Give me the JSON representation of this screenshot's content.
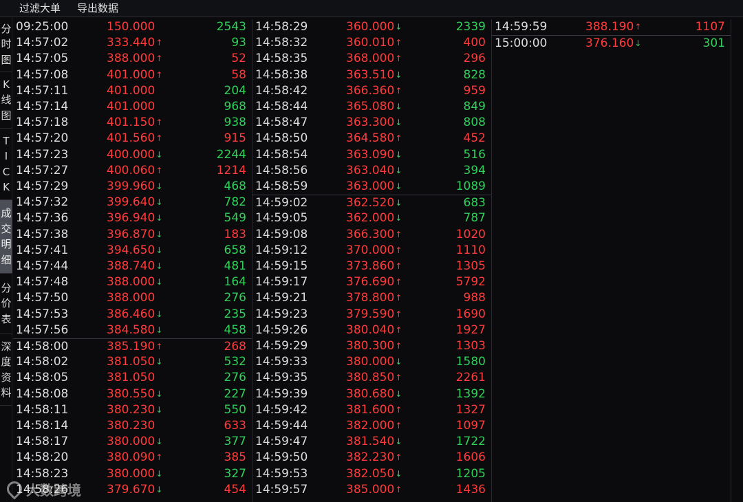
{
  "toolbar": {
    "filter_label": "过滤大单",
    "export_label": "导出数据"
  },
  "side_tabs": [
    {
      "chars": [
        "分",
        "时",
        "图"
      ],
      "active": false
    },
    {
      "chars": [
        "K",
        "线",
        "图"
      ],
      "active": false
    },
    {
      "chars": [
        "T",
        "I",
        "C",
        "K"
      ],
      "active": false
    },
    {
      "chars": [
        "成",
        "交",
        "明",
        "细"
      ],
      "active": true
    },
    {
      "chars": [
        "分",
        "价",
        "表"
      ],
      "active": false
    },
    {
      "chars": [
        "深",
        "度",
        "资",
        "料"
      ],
      "active": false
    }
  ],
  "colors": {
    "up": "#ff3b3b",
    "down": "#2fd15a",
    "active_tab": "#4b4e57"
  },
  "columns": [
    [
      {
        "t": "09:25:00",
        "p": "150.000",
        "d": "",
        "v": "2543",
        "s": "sell"
      },
      {
        "t": "14:57:02",
        "p": "333.440",
        "d": "up",
        "v": "93",
        "s": "sell"
      },
      {
        "t": "14:57:05",
        "p": "388.000",
        "d": "up",
        "v": "52",
        "s": "buy"
      },
      {
        "t": "14:57:08",
        "p": "401.000",
        "d": "up",
        "v": "58",
        "s": "buy"
      },
      {
        "t": "14:57:11",
        "p": "401.000",
        "d": "",
        "v": "204",
        "s": "sell"
      },
      {
        "t": "14:57:14",
        "p": "401.000",
        "d": "",
        "v": "968",
        "s": "sell"
      },
      {
        "t": "14:57:18",
        "p": "401.150",
        "d": "up",
        "v": "938",
        "s": "sell"
      },
      {
        "t": "14:57:20",
        "p": "401.560",
        "d": "up",
        "v": "915",
        "s": "buy"
      },
      {
        "t": "14:57:23",
        "p": "400.000",
        "d": "down",
        "v": "2244",
        "s": "sell"
      },
      {
        "t": "14:57:27",
        "p": "400.060",
        "d": "up",
        "v": "1214",
        "s": "buy"
      },
      {
        "t": "14:57:29",
        "p": "399.960",
        "d": "down",
        "v": "468",
        "s": "sell"
      },
      {
        "t": "14:57:32",
        "p": "399.640",
        "d": "down",
        "v": "782",
        "s": "sell"
      },
      {
        "t": "14:57:36",
        "p": "396.940",
        "d": "down",
        "v": "549",
        "s": "sell"
      },
      {
        "t": "14:57:38",
        "p": "396.870",
        "d": "down",
        "v": "183",
        "s": "buy"
      },
      {
        "t": "14:57:41",
        "p": "394.650",
        "d": "down",
        "v": "658",
        "s": "sell"
      },
      {
        "t": "14:57:44",
        "p": "388.740",
        "d": "down",
        "v": "481",
        "s": "sell"
      },
      {
        "t": "14:57:48",
        "p": "388.000",
        "d": "down",
        "v": "164",
        "s": "sell"
      },
      {
        "t": "14:57:50",
        "p": "388.000",
        "d": "",
        "v": "276",
        "s": "sell"
      },
      {
        "t": "14:57:53",
        "p": "386.460",
        "d": "down",
        "v": "235",
        "s": "sell"
      },
      {
        "t": "14:57:56",
        "p": "384.580",
        "d": "down",
        "v": "458",
        "s": "sell"
      },
      {
        "t": "14:58:00",
        "p": "385.190",
        "d": "up",
        "v": "268",
        "s": "buy",
        "sep": true
      },
      {
        "t": "14:58:02",
        "p": "381.050",
        "d": "down",
        "v": "532",
        "s": "sell"
      },
      {
        "t": "14:58:05",
        "p": "381.050",
        "d": "",
        "v": "276",
        "s": "sell"
      },
      {
        "t": "14:58:08",
        "p": "380.550",
        "d": "down",
        "v": "227",
        "s": "sell"
      },
      {
        "t": "14:58:11",
        "p": "380.230",
        "d": "down",
        "v": "550",
        "s": "sell"
      },
      {
        "t": "14:58:14",
        "p": "380.230",
        "d": "",
        "v": "633",
        "s": "buy"
      },
      {
        "t": "14:58:17",
        "p": "380.000",
        "d": "down",
        "v": "377",
        "s": "sell"
      },
      {
        "t": "14:58:20",
        "p": "380.090",
        "d": "up",
        "v": "385",
        "s": "buy"
      },
      {
        "t": "14:58:23",
        "p": "380.000",
        "d": "down",
        "v": "327",
        "s": "sell"
      },
      {
        "t": "14:58:26",
        "p": "379.670",
        "d": "down",
        "v": "454",
        "s": "buy"
      }
    ],
    [
      {
        "t": "14:58:29",
        "p": "360.000",
        "d": "down",
        "v": "2339",
        "s": "sell"
      },
      {
        "t": "14:58:32",
        "p": "360.010",
        "d": "up",
        "v": "400",
        "s": "buy"
      },
      {
        "t": "14:58:35",
        "p": "368.000",
        "d": "up",
        "v": "296",
        "s": "buy"
      },
      {
        "t": "14:58:38",
        "p": "363.510",
        "d": "down",
        "v": "828",
        "s": "sell"
      },
      {
        "t": "14:58:42",
        "p": "366.360",
        "d": "up",
        "v": "959",
        "s": "buy"
      },
      {
        "t": "14:58:44",
        "p": "365.080",
        "d": "down",
        "v": "849",
        "s": "sell"
      },
      {
        "t": "14:58:47",
        "p": "363.300",
        "d": "down",
        "v": "808",
        "s": "sell"
      },
      {
        "t": "14:58:50",
        "p": "364.580",
        "d": "up",
        "v": "452",
        "s": "buy"
      },
      {
        "t": "14:58:54",
        "p": "363.090",
        "d": "down",
        "v": "516",
        "s": "sell"
      },
      {
        "t": "14:58:56",
        "p": "363.040",
        "d": "down",
        "v": "394",
        "s": "sell"
      },
      {
        "t": "14:58:59",
        "p": "363.000",
        "d": "down",
        "v": "1089",
        "s": "sell"
      },
      {
        "t": "14:59:02",
        "p": "362.520",
        "d": "down",
        "v": "683",
        "s": "sell",
        "sep": true
      },
      {
        "t": "14:59:05",
        "p": "362.000",
        "d": "down",
        "v": "787",
        "s": "sell"
      },
      {
        "t": "14:59:08",
        "p": "366.300",
        "d": "up",
        "v": "1020",
        "s": "buy"
      },
      {
        "t": "14:59:12",
        "p": "370.000",
        "d": "up",
        "v": "1110",
        "s": "buy"
      },
      {
        "t": "14:59:15",
        "p": "373.860",
        "d": "up",
        "v": "1305",
        "s": "buy"
      },
      {
        "t": "14:59:17",
        "p": "376.690",
        "d": "up",
        "v": "5792",
        "s": "buy"
      },
      {
        "t": "14:59:21",
        "p": "378.800",
        "d": "up",
        "v": "988",
        "s": "buy"
      },
      {
        "t": "14:59:23",
        "p": "379.590",
        "d": "up",
        "v": "1690",
        "s": "buy"
      },
      {
        "t": "14:59:26",
        "p": "380.040",
        "d": "up",
        "v": "1927",
        "s": "buy"
      },
      {
        "t": "14:59:29",
        "p": "380.300",
        "d": "up",
        "v": "1303",
        "s": "buy"
      },
      {
        "t": "14:59:33",
        "p": "380.000",
        "d": "down",
        "v": "1580",
        "s": "sell"
      },
      {
        "t": "14:59:35",
        "p": "380.850",
        "d": "up",
        "v": "2261",
        "s": "buy"
      },
      {
        "t": "14:59:39",
        "p": "380.680",
        "d": "down",
        "v": "1392",
        "s": "sell"
      },
      {
        "t": "14:59:42",
        "p": "381.600",
        "d": "up",
        "v": "1327",
        "s": "buy"
      },
      {
        "t": "14:59:44",
        "p": "382.000",
        "d": "up",
        "v": "1097",
        "s": "buy"
      },
      {
        "t": "14:59:47",
        "p": "381.540",
        "d": "down",
        "v": "1722",
        "s": "sell"
      },
      {
        "t": "14:59:50",
        "p": "382.230",
        "d": "up",
        "v": "1606",
        "s": "buy"
      },
      {
        "t": "14:59:53",
        "p": "382.050",
        "d": "down",
        "v": "1205",
        "s": "sell"
      },
      {
        "t": "14:59:57",
        "p": "385.000",
        "d": "up",
        "v": "1436",
        "s": "buy"
      }
    ],
    [
      {
        "t": "14:59:59",
        "p": "388.190",
        "d": "up",
        "v": "1107",
        "s": "buy"
      },
      {
        "t": "15:00:00",
        "p": "376.160",
        "d": "down",
        "v": "301",
        "s": "sell",
        "sep": true
      }
    ]
  ],
  "watermark": {
    "text": "大数跨境"
  }
}
